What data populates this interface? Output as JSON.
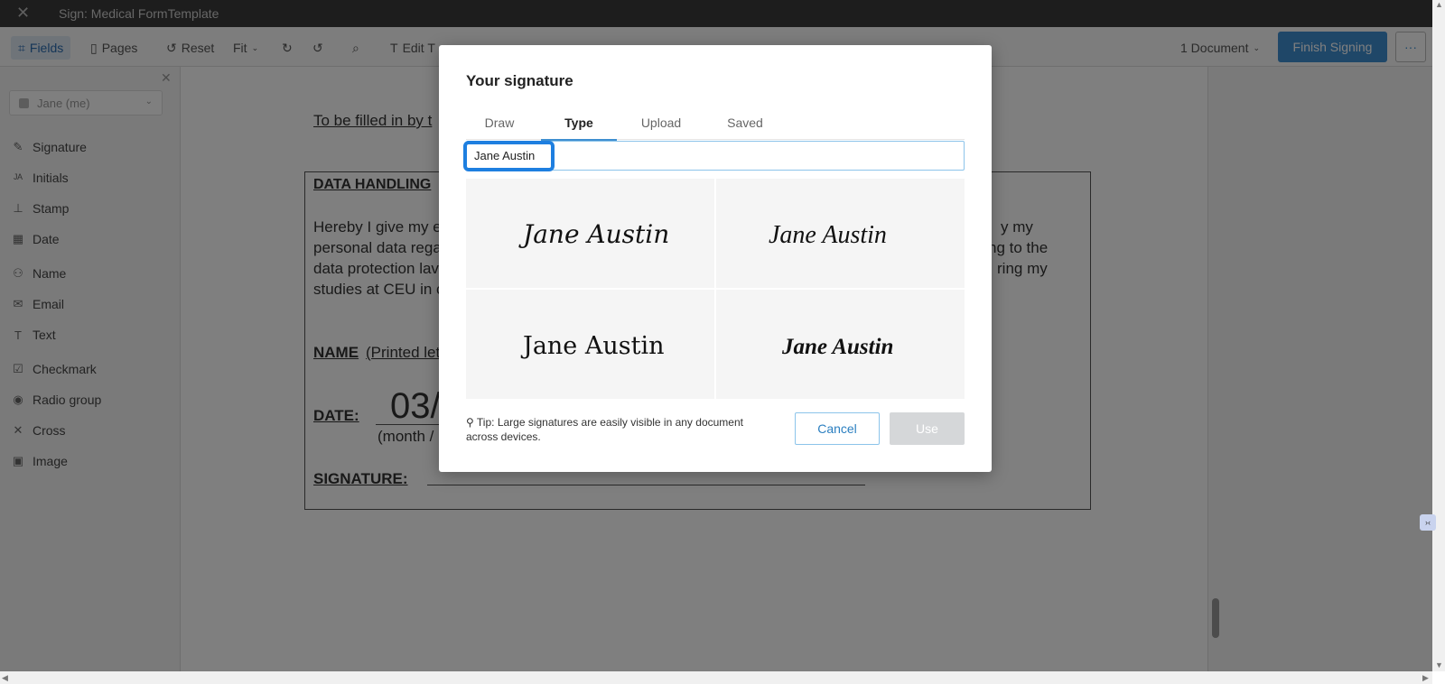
{
  "window": {
    "title": "Sign: Medical FormTemplate"
  },
  "toolbar": {
    "fields": "Fields",
    "pages": "Pages",
    "reset": "Reset",
    "fit": "Fit",
    "edit_text": "Edit T",
    "documents": "1 Document",
    "finish": "Finish Signing",
    "more": "···"
  },
  "sidebar": {
    "signer": "Jane (me)",
    "items": [
      {
        "label": "Signature",
        "icon": "pen-icon"
      },
      {
        "label": "Initials",
        "icon": "initials-icon"
      },
      {
        "label": "Stamp",
        "icon": "stamp-icon"
      },
      {
        "label": "Date",
        "icon": "calendar-icon"
      },
      {
        "label": "Name",
        "icon": "person-icon"
      },
      {
        "label": "Email",
        "icon": "mail-icon"
      },
      {
        "label": "Text",
        "icon": "text-icon"
      },
      {
        "label": "Checkmark",
        "icon": "checkbox-icon"
      },
      {
        "label": "Radio group",
        "icon": "radio-icon"
      },
      {
        "label": "Cross",
        "icon": "cross-icon"
      },
      {
        "label": "Image",
        "icon": "image-icon"
      }
    ]
  },
  "document": {
    "intro": "To be filled in by t",
    "heading": "DATA HANDLING",
    "para_left": [
      "Hereby I give my e",
      "personal data rega",
      "data protection lav",
      "studies at CEU in c"
    ],
    "para_right": [
      "y my",
      "ng to the",
      "ring my"
    ],
    "name_label": "NAME",
    "name_hint": "(Printed let",
    "date_label": "DATE:",
    "date_value": "03/",
    "date_hint": "(month /",
    "signature_label": "SIGNATURE:"
  },
  "modal": {
    "title": "Your signature",
    "tabs": [
      "Draw",
      "Type",
      "Upload",
      "Saved"
    ],
    "active_tab": "Type",
    "input_value": "Jane Austin",
    "options": [
      "Jane Austin",
      "Jane Austin",
      "Jane Austin",
      "Jane Austin"
    ],
    "tip": "Tip: Large signatures are easily visible in any document across devices.",
    "cancel": "Cancel",
    "use": "Use"
  },
  "colors": {
    "accent": "#3f8fd1",
    "focus": "#1e7fe0",
    "disabled": "#d5d7d9"
  }
}
